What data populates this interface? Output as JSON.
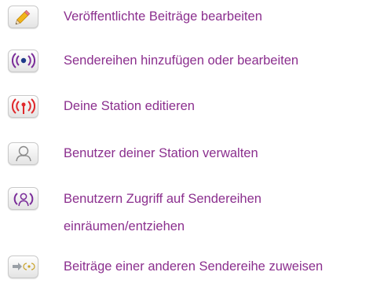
{
  "menu": {
    "items": [
      {
        "label": "Veröffentlichte Beiträge bearbeiten",
        "icon": "pencil-icon"
      },
      {
        "label": "Sendereihen hinzufügen oder bearbeiten",
        "icon": "broadcast-series-icon"
      },
      {
        "label": "Deine Station editieren",
        "icon": "station-antenna-icon"
      },
      {
        "label": "Benutzer deiner Station verwalten",
        "icon": "user-icon"
      },
      {
        "label": "Benutzern Zugriff auf Sendereihen",
        "label2": "einräumen/entziehen",
        "icon": "user-access-icon"
      },
      {
        "label": "Beiträge einer anderen Sendereihe zuweisen",
        "icon": "assign-arrow-icon"
      }
    ]
  },
  "colors": {
    "link": "#8b2f8e",
    "purple_icon": "#7a2c99",
    "red_icon": "#e0282b",
    "pencil": "#f1b51c"
  }
}
